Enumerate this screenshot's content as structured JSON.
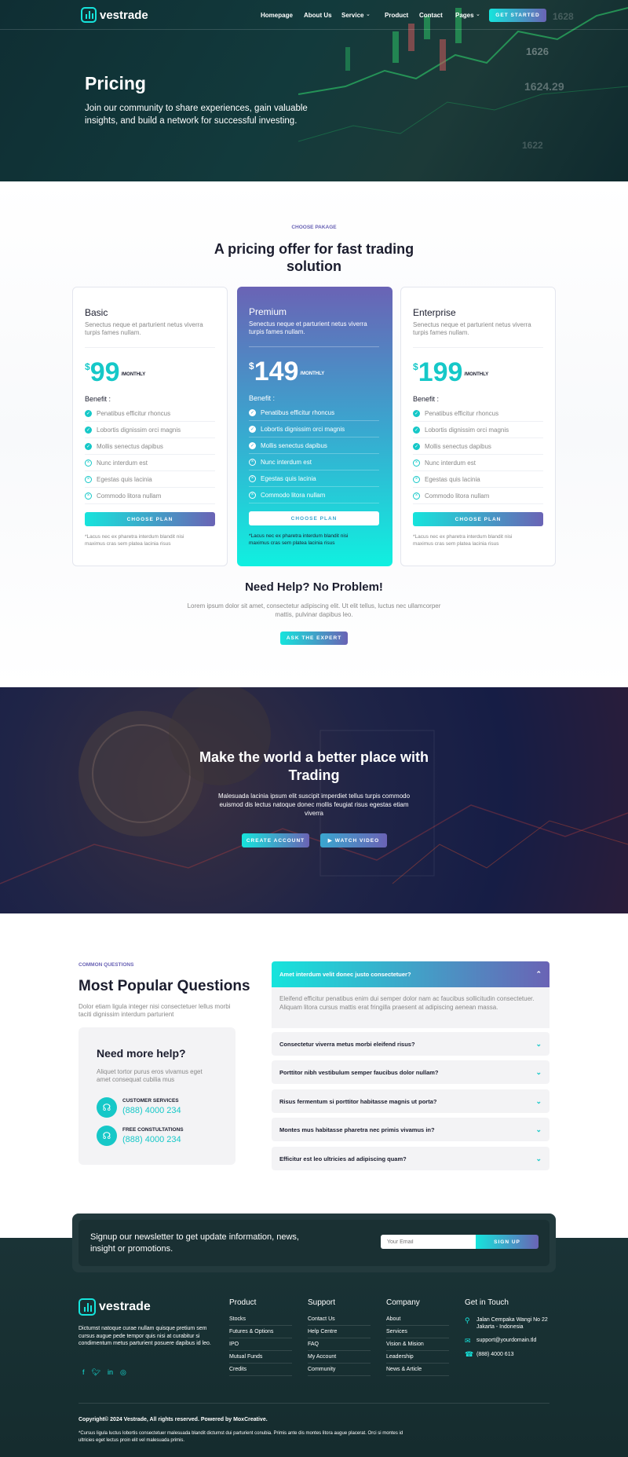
{
  "brand": {
    "name": "vestrade",
    "accent": "#16e4dc",
    "accent2": "#6a63b5"
  },
  "nav": {
    "items": [
      "Homepage",
      "About Us",
      "Service",
      "Product",
      "Contact",
      "Pages"
    ],
    "cta": "GET STARTED"
  },
  "hero": {
    "title": "Pricing",
    "subtitle": "Join our community to share experiences, gain valuable insights, and build a network for successful investing.",
    "ticker_values": [
      "1626",
      "1624.29",
      "1622",
      "1628"
    ]
  },
  "pricing": {
    "eyebrow": "CHOOSE PAKAGE",
    "heading": "A pricing offer for fast trading solution",
    "currency": "$",
    "period": "/MONTHLY",
    "benefit_label": "Benefit :",
    "button": "CHOOSE PLAN",
    "note": "*Lacus nec ex pharetra interdum blandit nisi maximus cras sem platea lacinia risus",
    "features": [
      "Penatibus efficitur rhoncus",
      "Lobortis dignissim orci magnis",
      "Mollis senectus dapibus",
      "Nunc interdum est",
      "Egestas quis lacinia",
      "Commodo litora nullam"
    ],
    "feature_included": [
      true,
      true,
      true,
      false,
      false,
      false
    ],
    "plans": [
      {
        "name": "Basic",
        "desc": "Senectus neque et parturient netus viverra turpis fames nullam.",
        "price": "99"
      },
      {
        "name": "Premium",
        "desc": "Senectus neque et parturient netus viverra turpis fames nullam.",
        "price": "149"
      },
      {
        "name": "Enterprise",
        "desc": "Senectus neque et parturient netus viverra turpis fames nullam.",
        "price": "199"
      }
    ]
  },
  "help": {
    "title": "Need Help? No Problem!",
    "text": "Lorem ipsum dolor sit amet, consectetur adipiscing elit. Ut elit tellus, luctus nec ullamcorper mattis, pulvinar dapibus leo.",
    "button": "ASK THE EXPERT"
  },
  "cta": {
    "title": "Make the world a better place with Trading",
    "text": "Malesuada lacinia ipsum elit suscipit imperdiet tellus turpis commodo euismod dis lectus natoque donec mollis feugiat risus egestas etiam viverra",
    "primary": "CREATE ACCOUNT",
    "secondary": "WATCH VIDEO"
  },
  "faq": {
    "eyebrow": "COMMON QUESTIONS",
    "title": "Most Popular Questions",
    "text": "Dolor etiam ligula integer nisi consectetuer lellus morbi taciti dignissim interdum parturient",
    "help_title": "Need more help?",
    "help_text": "Aliquet tortor purus eros vivamus eget amet consequat cubilia mus",
    "contacts": [
      {
        "label": "CUSTOMER SERVICES",
        "phone": "(888) 4000 234"
      },
      {
        "label": "FREE CONSTULTATIONS",
        "phone": "(888) 4000 234"
      }
    ],
    "open_question": "Amet interdum velit donec justo consectetuer?",
    "open_answer": "Eleifend efficitur penatibus enim dui semper dolor nam ac faucibus sollicitudin consectetuer. Aliquam litora cursus mattis erat fringilla praesent at adipiscing aenean massa.",
    "questions": [
      "Consectetur viverra metus morbi eleifend risus?",
      "Porttitor nibh vestibulum semper faucibus dolor nullam?",
      "Risus fermentum si porttitor habitasse magnis ut porta?",
      "Montes mus habitasse pharetra nec primis vivamus in?",
      "Efficitur est leo ultricies ad adipiscing quam?"
    ]
  },
  "newsletter": {
    "text": "Signup our newsletter to get update information, news, insight or promotions.",
    "placeholder": "Your Email",
    "button": "SIGN UP"
  },
  "footer": {
    "about": "Dictumst natoque curae nullam quisque pretium sem cursus augue pede tempor quis nisi at curabitur si condimentum metus parturient posuere dapibus id leo.",
    "columns": [
      {
        "title": "Product",
        "links": [
          "Stocks",
          "Futures & Options",
          "IPO",
          "Mutual Funds",
          "Credits"
        ]
      },
      {
        "title": "Support",
        "links": [
          "Contact Us",
          "Help Centre",
          "FAQ",
          "My Account",
          "Community"
        ]
      },
      {
        "title": "Company",
        "links": [
          "About",
          "Services",
          "Vision & Mision",
          "Leadership",
          "News & Article"
        ]
      }
    ],
    "contact_title": "Get in Touch",
    "address": "Jalan Cempaka Wangi No 22 Jakarta - Indonesia",
    "email": "support@yourdomain.tld",
    "phone": "(888) 4000 613",
    "copyright": "Copyright© 2024 Vestrade, All rights reserved. Powered by MoxCreative.",
    "disclaimer": "*Cursus ligula luctus lobortis consectetuer malesuada blandit dictumst dui parturient conubia. Primis ante dis montes litora augue placerat. Orci si montes id ultricies eget lectus proin elit vel malesuada primis."
  }
}
